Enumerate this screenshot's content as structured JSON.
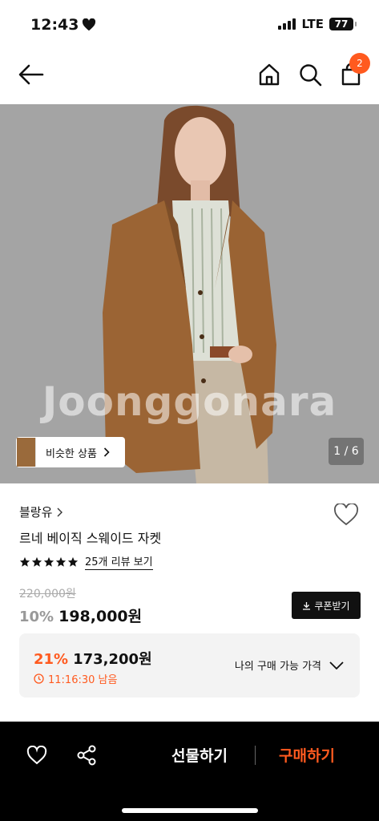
{
  "status_bar": {
    "time": "12:43",
    "network": "LTE",
    "battery": "77"
  },
  "header": {
    "cart_count": "2"
  },
  "gallery": {
    "watermark": "Joonggonara",
    "similar_label": "비슷한 상품",
    "counter": "1 / 6"
  },
  "product": {
    "brand": "블랑유",
    "name": "르네 베이직 스웨이드 자켓",
    "rating_stars": 5,
    "review_link": "25개 리뷰 보기",
    "original_price": "220,000원",
    "discount": "10%",
    "price": "198,000원",
    "coupon_label": "쿠폰받기"
  },
  "my_price": {
    "discount": "21%",
    "amount": "173,200원",
    "timer": "11:16:30 남음",
    "label": "나의 구매 가능 가격"
  },
  "bottom_bar": {
    "gift_label": "선물하기",
    "buy_label": "구매하기"
  },
  "colors": {
    "accent": "#ff5a1f",
    "dark": "#000000",
    "panel": "#f3f3f3"
  }
}
